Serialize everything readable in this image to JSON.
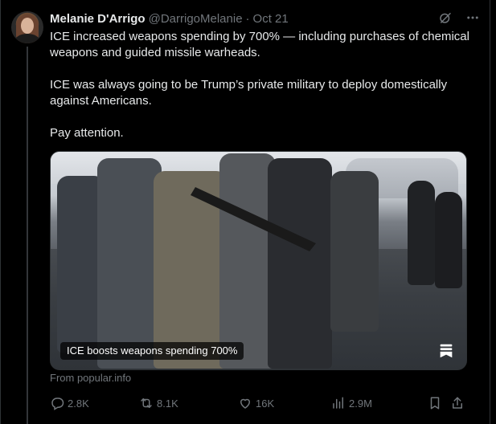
{
  "tweet": {
    "author_name": "Melanie D'Arrigo",
    "author_handle": "@DarrigoMelanie",
    "separator": "·",
    "date": "Oct 21",
    "paragraphs": [
      "ICE increased weapons spending by 700% — including purchases of chemical weapons and guided missile warheads.",
      "ICE was always going to be Trump’s private military to deploy domestically against Americans.",
      "Pay attention."
    ]
  },
  "media": {
    "caption": "ICE boosts weapons spending 700%",
    "source_label": "From popular.info"
  },
  "actions": {
    "replies": "2.8K",
    "reposts": "8.1K",
    "likes": "16K",
    "views": "2.9M"
  },
  "icons": {
    "top": [
      "grok-icon",
      "more-icon"
    ],
    "bottom": [
      "reply-icon",
      "repost-icon",
      "like-icon",
      "views-icon",
      "bookmark-icon",
      "share-icon"
    ]
  },
  "colors": {
    "background": "#000000",
    "text": "#e7e9ea",
    "muted": "#71767b",
    "border": "#2f3336"
  }
}
